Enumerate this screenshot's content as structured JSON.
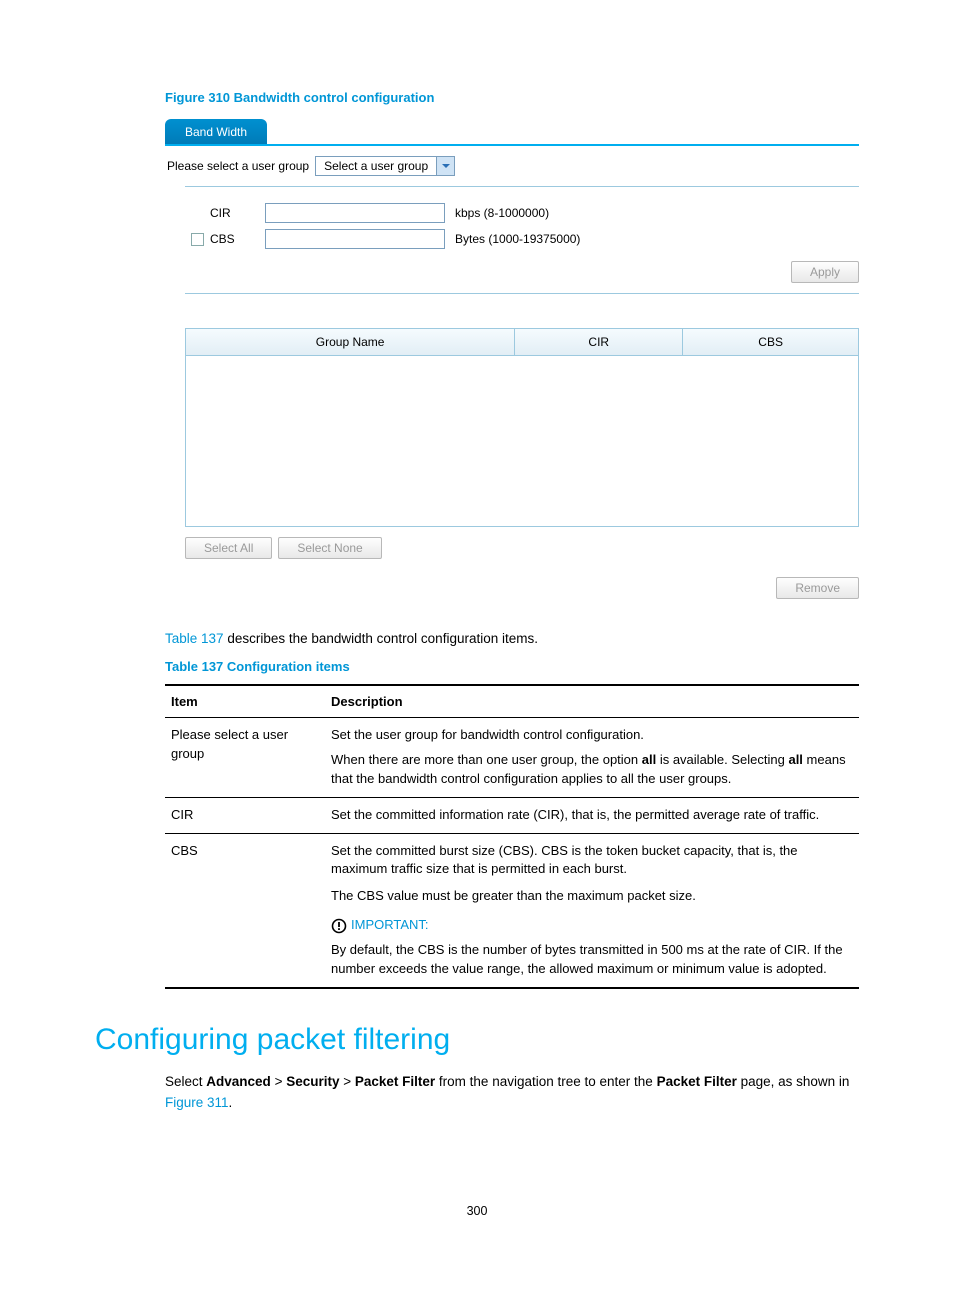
{
  "figure_title": "Figure 310 Bandwidth control configuration",
  "screenshot": {
    "tab_label": "Band Width",
    "user_group_label": "Please select a user group",
    "user_group_select": "Select a user group",
    "cir_label": "CIR",
    "cir_unit": "kbps (8-1000000)",
    "cbs_label": "CBS",
    "cbs_unit": "Bytes (1000-19375000)",
    "apply": "Apply",
    "col_group": "Group Name",
    "col_cir": "CIR",
    "col_cbs": "CBS",
    "select_all": "Select All",
    "select_none": "Select None",
    "remove": "Remove"
  },
  "para1_pre": "Table 137",
  "para1_post": " describes the bandwidth control configuration items.",
  "table_title": "Table 137 Configuration items",
  "th_item": "Item",
  "th_desc": "Description",
  "row1": {
    "item": "Please select a user group",
    "line1": "Set the user group for bandwidth control configuration.",
    "line2a": "When there are more than one user group, the option ",
    "line2b": "all",
    "line2c": " is available. Selecting ",
    "line2d": "all",
    "line2e": " means that the bandwidth control configuration applies to all the user groups."
  },
  "row2": {
    "item": "CIR",
    "desc": "Set the committed information rate (CIR), that is, the permitted average rate of traffic."
  },
  "row3": {
    "item": "CBS",
    "line1": "Set the committed burst size (CBS). CBS is the token bucket capacity, that is, the maximum traffic size that is permitted in each burst.",
    "line2": "The CBS value must be greater than the maximum packet size.",
    "important": "IMPORTANT:",
    "line3": "By default, the CBS is the number of bytes transmitted in 500 ms at the rate of CIR. If the number exceeds the value range, the allowed maximum or minimum value is adopted."
  },
  "heading": "Configuring packet filtering",
  "nav": {
    "pre": "Select ",
    "b1": "Advanced",
    "gt1": " > ",
    "b2": "Security",
    "gt2": " > ",
    "b3": "Packet Filter",
    "mid": " from the navigation tree to enter the ",
    "b4": "Packet Filter",
    "post": " page, as shown in ",
    "link": "Figure 311",
    "dot": "."
  },
  "page_number": "300"
}
